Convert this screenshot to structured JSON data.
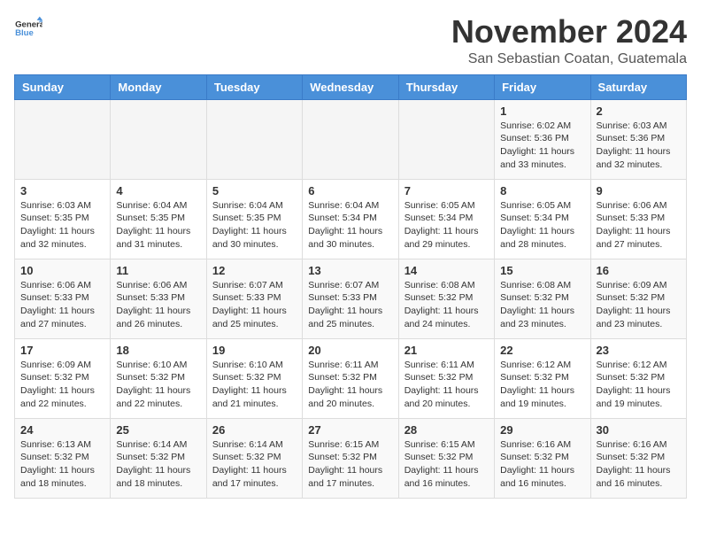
{
  "header": {
    "logo_general": "General",
    "logo_blue": "Blue",
    "month": "November 2024",
    "location": "San Sebastian Coatan, Guatemala"
  },
  "days_of_week": [
    "Sunday",
    "Monday",
    "Tuesday",
    "Wednesday",
    "Thursday",
    "Friday",
    "Saturday"
  ],
  "weeks": [
    [
      {
        "day": "",
        "info": ""
      },
      {
        "day": "",
        "info": ""
      },
      {
        "day": "",
        "info": ""
      },
      {
        "day": "",
        "info": ""
      },
      {
        "day": "",
        "info": ""
      },
      {
        "day": "1",
        "info": "Sunrise: 6:02 AM\nSunset: 5:36 PM\nDaylight: 11 hours\nand 33 minutes."
      },
      {
        "day": "2",
        "info": "Sunrise: 6:03 AM\nSunset: 5:36 PM\nDaylight: 11 hours\nand 32 minutes."
      }
    ],
    [
      {
        "day": "3",
        "info": "Sunrise: 6:03 AM\nSunset: 5:35 PM\nDaylight: 11 hours\nand 32 minutes."
      },
      {
        "day": "4",
        "info": "Sunrise: 6:04 AM\nSunset: 5:35 PM\nDaylight: 11 hours\nand 31 minutes."
      },
      {
        "day": "5",
        "info": "Sunrise: 6:04 AM\nSunset: 5:35 PM\nDaylight: 11 hours\nand 30 minutes."
      },
      {
        "day": "6",
        "info": "Sunrise: 6:04 AM\nSunset: 5:34 PM\nDaylight: 11 hours\nand 30 minutes."
      },
      {
        "day": "7",
        "info": "Sunrise: 6:05 AM\nSunset: 5:34 PM\nDaylight: 11 hours\nand 29 minutes."
      },
      {
        "day": "8",
        "info": "Sunrise: 6:05 AM\nSunset: 5:34 PM\nDaylight: 11 hours\nand 28 minutes."
      },
      {
        "day": "9",
        "info": "Sunrise: 6:06 AM\nSunset: 5:33 PM\nDaylight: 11 hours\nand 27 minutes."
      }
    ],
    [
      {
        "day": "10",
        "info": "Sunrise: 6:06 AM\nSunset: 5:33 PM\nDaylight: 11 hours\nand 27 minutes."
      },
      {
        "day": "11",
        "info": "Sunrise: 6:06 AM\nSunset: 5:33 PM\nDaylight: 11 hours\nand 26 minutes."
      },
      {
        "day": "12",
        "info": "Sunrise: 6:07 AM\nSunset: 5:33 PM\nDaylight: 11 hours\nand 25 minutes."
      },
      {
        "day": "13",
        "info": "Sunrise: 6:07 AM\nSunset: 5:33 PM\nDaylight: 11 hours\nand 25 minutes."
      },
      {
        "day": "14",
        "info": "Sunrise: 6:08 AM\nSunset: 5:32 PM\nDaylight: 11 hours\nand 24 minutes."
      },
      {
        "day": "15",
        "info": "Sunrise: 6:08 AM\nSunset: 5:32 PM\nDaylight: 11 hours\nand 23 minutes."
      },
      {
        "day": "16",
        "info": "Sunrise: 6:09 AM\nSunset: 5:32 PM\nDaylight: 11 hours\nand 23 minutes."
      }
    ],
    [
      {
        "day": "17",
        "info": "Sunrise: 6:09 AM\nSunset: 5:32 PM\nDaylight: 11 hours\nand 22 minutes."
      },
      {
        "day": "18",
        "info": "Sunrise: 6:10 AM\nSunset: 5:32 PM\nDaylight: 11 hours\nand 22 minutes."
      },
      {
        "day": "19",
        "info": "Sunrise: 6:10 AM\nSunset: 5:32 PM\nDaylight: 11 hours\nand 21 minutes."
      },
      {
        "day": "20",
        "info": "Sunrise: 6:11 AM\nSunset: 5:32 PM\nDaylight: 11 hours\nand 20 minutes."
      },
      {
        "day": "21",
        "info": "Sunrise: 6:11 AM\nSunset: 5:32 PM\nDaylight: 11 hours\nand 20 minutes."
      },
      {
        "day": "22",
        "info": "Sunrise: 6:12 AM\nSunset: 5:32 PM\nDaylight: 11 hours\nand 19 minutes."
      },
      {
        "day": "23",
        "info": "Sunrise: 6:12 AM\nSunset: 5:32 PM\nDaylight: 11 hours\nand 19 minutes."
      }
    ],
    [
      {
        "day": "24",
        "info": "Sunrise: 6:13 AM\nSunset: 5:32 PM\nDaylight: 11 hours\nand 18 minutes."
      },
      {
        "day": "25",
        "info": "Sunrise: 6:14 AM\nSunset: 5:32 PM\nDaylight: 11 hours\nand 18 minutes."
      },
      {
        "day": "26",
        "info": "Sunrise: 6:14 AM\nSunset: 5:32 PM\nDaylight: 11 hours\nand 17 minutes."
      },
      {
        "day": "27",
        "info": "Sunrise: 6:15 AM\nSunset: 5:32 PM\nDaylight: 11 hours\nand 17 minutes."
      },
      {
        "day": "28",
        "info": "Sunrise: 6:15 AM\nSunset: 5:32 PM\nDaylight: 11 hours\nand 16 minutes."
      },
      {
        "day": "29",
        "info": "Sunrise: 6:16 AM\nSunset: 5:32 PM\nDaylight: 11 hours\nand 16 minutes."
      },
      {
        "day": "30",
        "info": "Sunrise: 6:16 AM\nSunset: 5:32 PM\nDaylight: 11 hours\nand 16 minutes."
      }
    ]
  ]
}
